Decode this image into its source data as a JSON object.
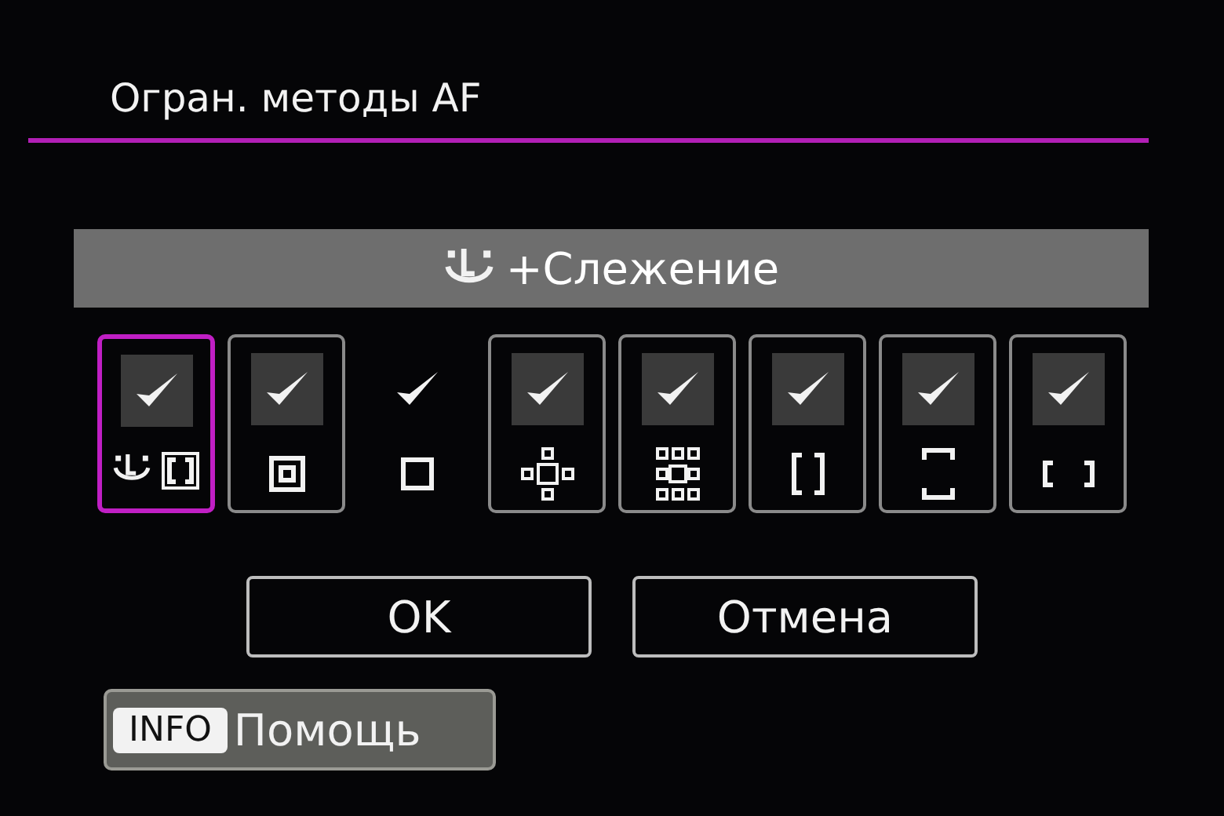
{
  "title": "Огран. методы AF",
  "banner": {
    "label": "+Слежение"
  },
  "methods": [
    {
      "kind": "face",
      "checked": true,
      "selected": true,
      "locked": false
    },
    {
      "kind": "spot",
      "checked": true,
      "selected": false,
      "locked": false
    },
    {
      "kind": "single",
      "checked": true,
      "selected": false,
      "locked": true
    },
    {
      "kind": "expand4",
      "checked": true,
      "selected": false,
      "locked": false
    },
    {
      "kind": "expand8",
      "checked": true,
      "selected": false,
      "locked": false
    },
    {
      "kind": "zone",
      "checked": true,
      "selected": false,
      "locked": false
    },
    {
      "kind": "large-zone-v",
      "checked": true,
      "selected": false,
      "locked": false
    },
    {
      "kind": "large-zone-h",
      "checked": true,
      "selected": false,
      "locked": false
    }
  ],
  "buttons": [
    "OK",
    "Отмена"
  ],
  "help": {
    "key": "INFO",
    "label": "Помощь"
  }
}
